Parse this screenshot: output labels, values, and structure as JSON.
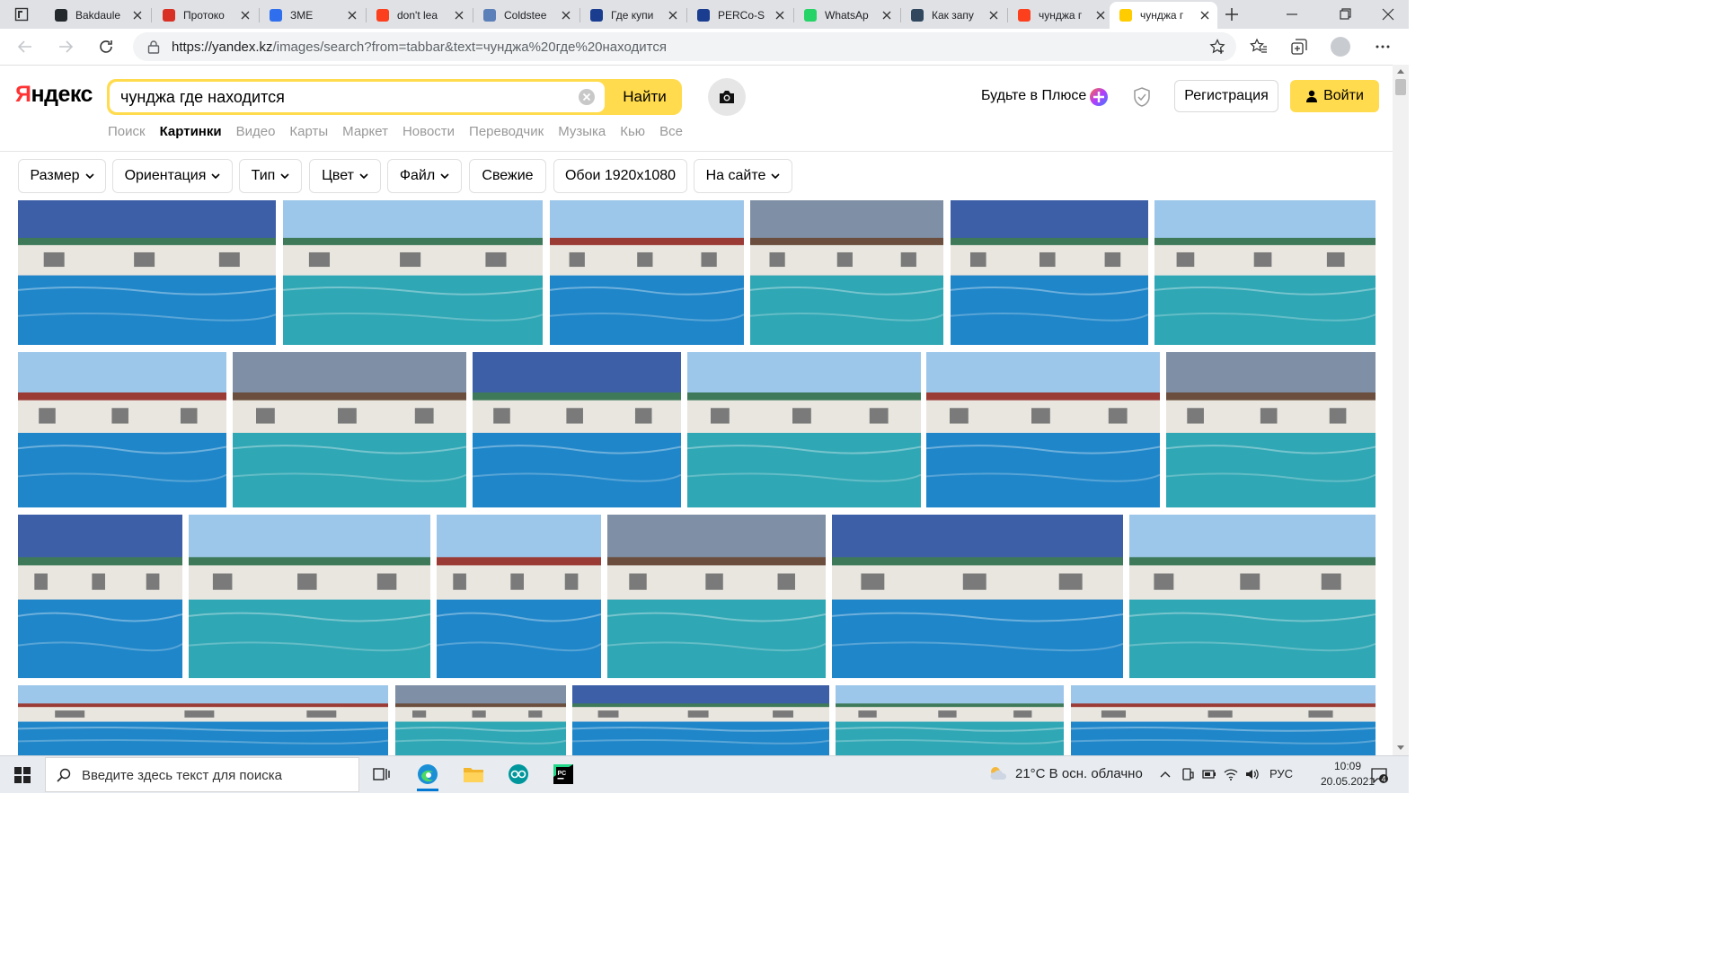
{
  "browser": {
    "tabs": [
      {
        "title": "Bakdaule",
        "icon": "github-icon"
      },
      {
        "title": "Протоко",
        "icon": "pdf-icon"
      },
      {
        "title": "ЗМЕ",
        "icon": "video-icon"
      },
      {
        "title": "don't lea",
        "icon": "yandex-icon"
      },
      {
        "title": "Coldstee",
        "icon": "document-icon"
      },
      {
        "title": "Где купи",
        "icon": "perco-icon"
      },
      {
        "title": "PERCo-S",
        "icon": "perco-icon"
      },
      {
        "title": "WhatsAp",
        "icon": "whatsapp-icon"
      },
      {
        "title": "Как запу",
        "icon": "app-icon"
      },
      {
        "title": "чунджа г",
        "icon": "yandex-icon"
      },
      {
        "title": "чунджа г",
        "icon": "yandex-images-icon",
        "active": true
      }
    ],
    "url_host": "https://yandex.kz",
    "url_path": "/images/search?from=tabbar&text=чунджа%20где%20находится"
  },
  "header": {
    "logo_red": "Я",
    "logo_black": "ндекс",
    "search_value": "чунджа где находится",
    "search_button": "Найти",
    "plus_promo": "Будьте в Плюсе",
    "register_button": "Регистрация",
    "login_button": "Войти",
    "services": [
      {
        "label": "Поиск"
      },
      {
        "label": "Картинки",
        "active": true
      },
      {
        "label": "Видео"
      },
      {
        "label": "Карты"
      },
      {
        "label": "Маркет"
      },
      {
        "label": "Новости"
      },
      {
        "label": "Переводчик"
      },
      {
        "label": "Музыка"
      },
      {
        "label": "Кью"
      },
      {
        "label": "Все"
      }
    ]
  },
  "filters": [
    {
      "label": "Размер",
      "dropdown": true
    },
    {
      "label": "Ориентация",
      "dropdown": true
    },
    {
      "label": "Тип",
      "dropdown": true
    },
    {
      "label": "Цвет",
      "dropdown": true
    },
    {
      "label": "Файл",
      "dropdown": true
    },
    {
      "label": "Свежие",
      "dropdown": false
    },
    {
      "label": "Обои 1920x1080",
      "dropdown": false
    },
    {
      "label": "На сайте",
      "dropdown": true
    }
  ],
  "image_results": {
    "theme_colors": {
      "sky_evening": "#3d5fa8",
      "sky_day": "#9cc7ea",
      "water_teal": "#2fa7b4",
      "water_blue": "#1f86c9",
      "building_white": "#e9e6df",
      "roof_green": "#3e7a5a",
      "roof_red": "#9b3b36"
    }
  },
  "taskbar": {
    "search_placeholder": "Введите здесь текст для поиска",
    "weather_text": "21°C В осн. облачно",
    "language": "РУС",
    "time": "10:09",
    "date": "20.05.2021",
    "notification_count": "4"
  }
}
